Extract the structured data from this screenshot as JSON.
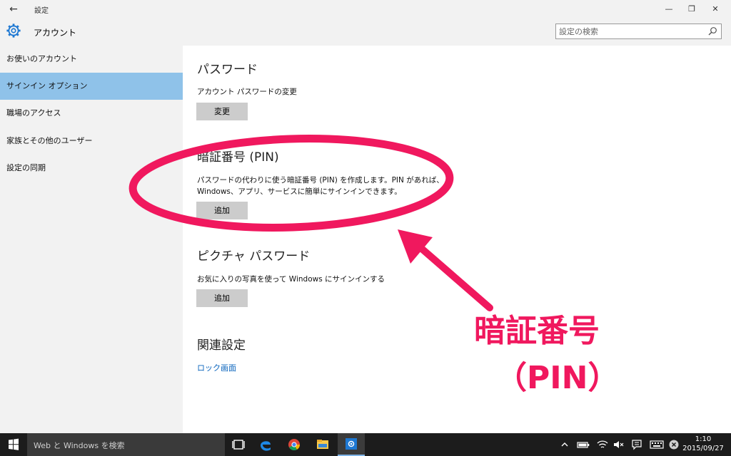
{
  "window": {
    "back_glyph": "←",
    "title": "設定",
    "minimize_glyph": "—",
    "restore_glyph": "❐",
    "close_glyph": "✕"
  },
  "header": {
    "icon": "gear-icon",
    "title": "アカウント",
    "search_placeholder": "設定の検索"
  },
  "sidebar": {
    "items": [
      {
        "label": "お使いのアカウント",
        "selected": false
      },
      {
        "label": "サインイン オプション",
        "selected": true
      },
      {
        "label": "職場のアクセス",
        "selected": false
      },
      {
        "label": "家族とその他のユーザー",
        "selected": false
      },
      {
        "label": "設定の同期",
        "selected": false
      }
    ]
  },
  "main": {
    "password": {
      "heading": "パスワード",
      "description": "アカウント パスワードの変更",
      "button": "変更"
    },
    "pin": {
      "heading": "暗証番号 (PIN)",
      "description_line1": "パスワードの代わりに使う暗証番号 (PIN) を作成します。PIN があれば、",
      "description_line2": "Windows、アプリ、サービスに簡単にサインインできます。",
      "button": "追加"
    },
    "picture_password": {
      "heading": "ピクチャ パスワード",
      "description": "お気に入りの写真を使って Windows にサインインする",
      "button": "追加"
    },
    "related": {
      "heading": "関連設定",
      "link": "ロック画面"
    }
  },
  "annotation": {
    "label_line1": "暗証番号",
    "label_line2": "（PIN）",
    "color": "#f0185e"
  },
  "taskbar": {
    "search_text": "Web と Windows を検索",
    "icons": [
      "windows-start-icon",
      "task-view-icon",
      "edge-icon",
      "chrome-icon",
      "file-explorer-icon",
      "settings-app-icon"
    ],
    "tray_icons": [
      "chevron-up-icon",
      "battery-icon",
      "wifi-icon",
      "volume-icon",
      "action-center-icon",
      "keyboard-icon",
      "close-circle-icon"
    ],
    "time": "1:10",
    "date": "2015/09/27"
  },
  "colors": {
    "sidebar_bg": "#f2f2f2",
    "selected_bg": "#8fc2e9",
    "link": "#0a64bd",
    "accent": "#1e78d2"
  }
}
